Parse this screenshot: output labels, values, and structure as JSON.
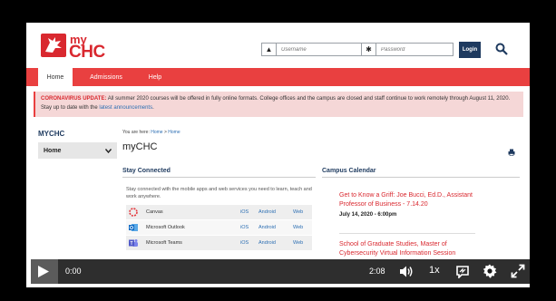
{
  "brand": {
    "my": "my",
    "chc": "CHC"
  },
  "login": {
    "username_placeholder": "Username",
    "password_placeholder": "Password",
    "login_label": "Login"
  },
  "nav": {
    "tabs": [
      {
        "label": "Home"
      },
      {
        "label": "Admissions"
      },
      {
        "label": "Help"
      }
    ]
  },
  "alert": {
    "lead": "CORONAVIRUS UPDATE:",
    "body": " All summer 2020 courses will be offered in fully online formats. College offices and the campus are closed and staff continue to work remotely through August 11, 2020. Stay up to date with the ",
    "link": "latest announcements",
    "end": "."
  },
  "sidebar": {
    "title": "MYCHC",
    "selected": "Home"
  },
  "breadcrumb": {
    "prefix": "You are here:",
    "items": [
      "Home",
      "Home"
    ]
  },
  "page_title": "myCHC",
  "stay_connected": {
    "title": "Stay Connected",
    "description": "Stay connected with the mobile apps and web services you need to learn, teach and work anywhere.",
    "apps": [
      {
        "name": "Canvas",
        "ios": "iOS",
        "android": "Android",
        "web": "Web",
        "icon": "canvas-icon",
        "color": "#e4363b"
      },
      {
        "name": "Microsoft Outlook",
        "ios": "iOS",
        "android": "Android",
        "web": "Web",
        "icon": "outlook-icon",
        "color": "#0f6cc6"
      },
      {
        "name": "Microsoft Teams",
        "ios": "iOS",
        "android": "Android",
        "web": "Web",
        "icon": "teams-icon",
        "color": "#5059c9"
      }
    ]
  },
  "calendar": {
    "title": "Campus Calendar",
    "events": [
      {
        "title": "Get to Know a Griff: Joe Bucci, Ed.D., Assistant Professor of Business - 7.14.20",
        "date": "July 14, 2020 - 6:00pm"
      },
      {
        "title": "School of Graduate Studies, Master of Cybersecurity Virtual Information Session",
        "date": ""
      }
    ]
  },
  "video": {
    "current_time": "0:00",
    "duration": "2:08",
    "speed": "1x",
    "played_fraction": 0.0
  },
  "colors": {
    "brand_red": "#d9282f",
    "nav_red": "#e94040",
    "navy": "#1e3a5f",
    "link_blue": "#2d6fb3"
  }
}
